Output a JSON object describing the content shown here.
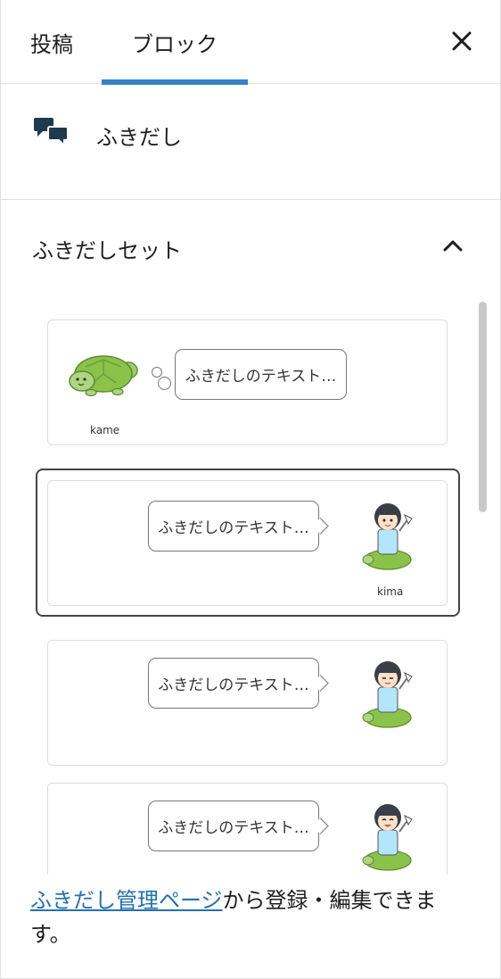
{
  "tabs": {
    "post": "投稿",
    "block": "ブロック"
  },
  "block": {
    "title": "ふきだし",
    "icon": "speech-bubbles-icon"
  },
  "panel": {
    "title": "ふきだしセット",
    "expanded": true
  },
  "balloons": [
    {
      "text": "ふきだしのテキスト…",
      "name": "kame",
      "avatar": "turtle",
      "style": "thought",
      "side": "left"
    },
    {
      "text": "ふきだしのテキスト…",
      "name": "kima",
      "avatar": "girl-on-turtle",
      "style": "speech",
      "side": "right",
      "selected": true
    },
    {
      "text": "ふきだしのテキスト…",
      "name": "",
      "avatar": "girl-on-turtle",
      "style": "speech",
      "side": "right"
    },
    {
      "text": "ふきだしのテキスト…",
      "name": "",
      "avatar": "girl-on-turtle",
      "style": "speech",
      "side": "right"
    }
  ],
  "footer": {
    "link_text": "ふきだし管理ページ",
    "text": "から登録・編集できます。"
  },
  "colors": {
    "accent": "#3582c4",
    "link": "#2271b1",
    "turtle": "#8bc34a"
  }
}
